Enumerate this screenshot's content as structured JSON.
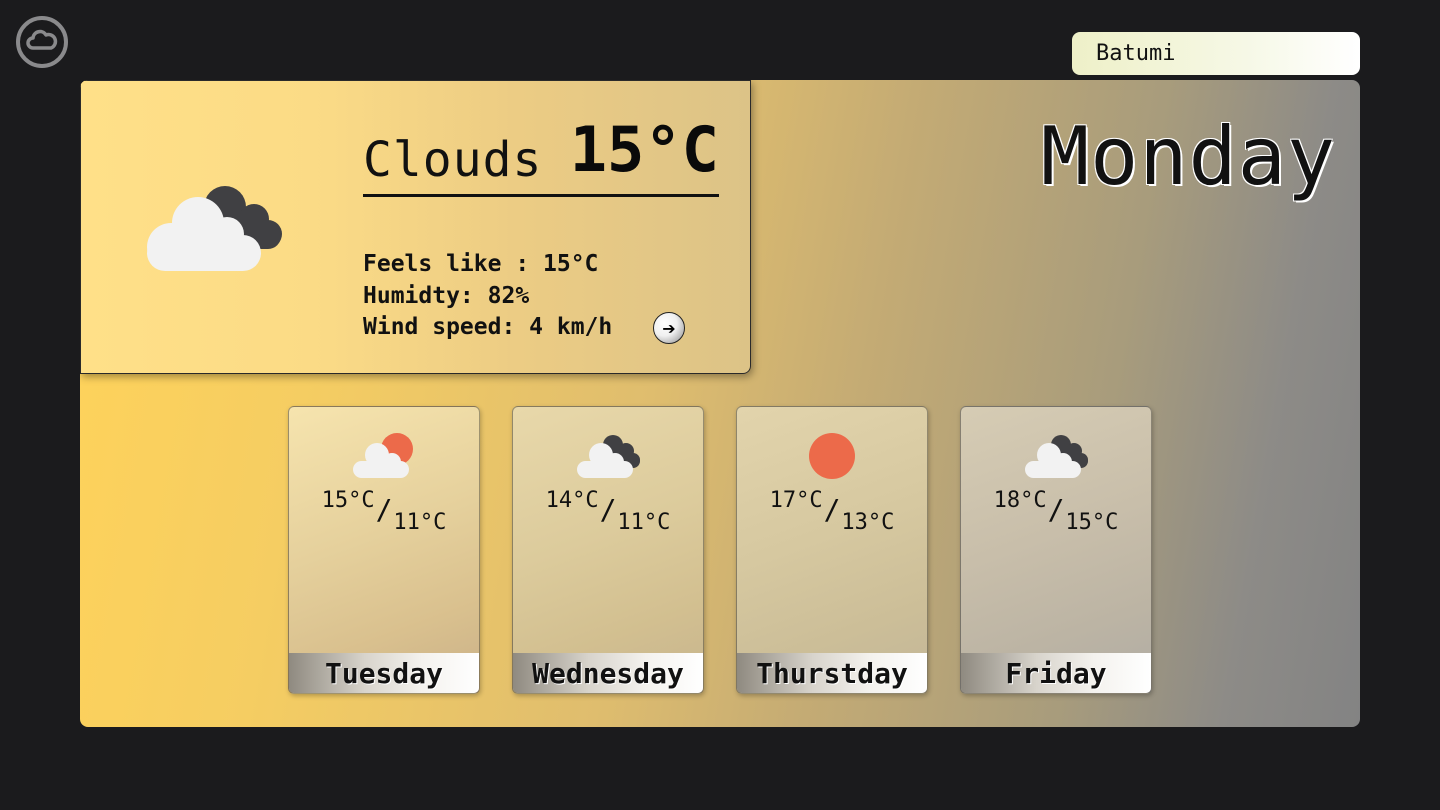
{
  "app": {
    "logo_icon": "cloud-circle-icon"
  },
  "search": {
    "value": "Batumi"
  },
  "current": {
    "condition": "Clouds",
    "temperature": "15°C",
    "feels_like": "Feels like : 15°C",
    "humidity": "Humidty: 82%",
    "wind": "Wind speed: 4 km/h",
    "wind_icon": "arrow-right-icon",
    "icon": "clouds-icon",
    "day": "Monday"
  },
  "forecast": [
    {
      "high": "15°C",
      "separator": "/",
      "low": "11°C",
      "day": "Tuesday",
      "icon": "cloud-sun-icon"
    },
    {
      "high": "14°C",
      "separator": "/",
      "low": "11°C",
      "day": "Wednesday",
      "icon": "clouds-icon"
    },
    {
      "high": "17°C",
      "separator": "/",
      "low": "13°C",
      "day": "Thurstday",
      "icon": "sun-icon"
    },
    {
      "high": "18°C",
      "separator": "/",
      "low": "15°C",
      "day": "Friday",
      "icon": "clouds-icon"
    }
  ],
  "colors": {
    "background": "#1b1b1d",
    "sun": "#ec6a4a",
    "cloud_light": "#f2f2f2",
    "cloud_dark": "#404043",
    "panel_start": "#ffd35a",
    "panel_end": "#838383"
  }
}
